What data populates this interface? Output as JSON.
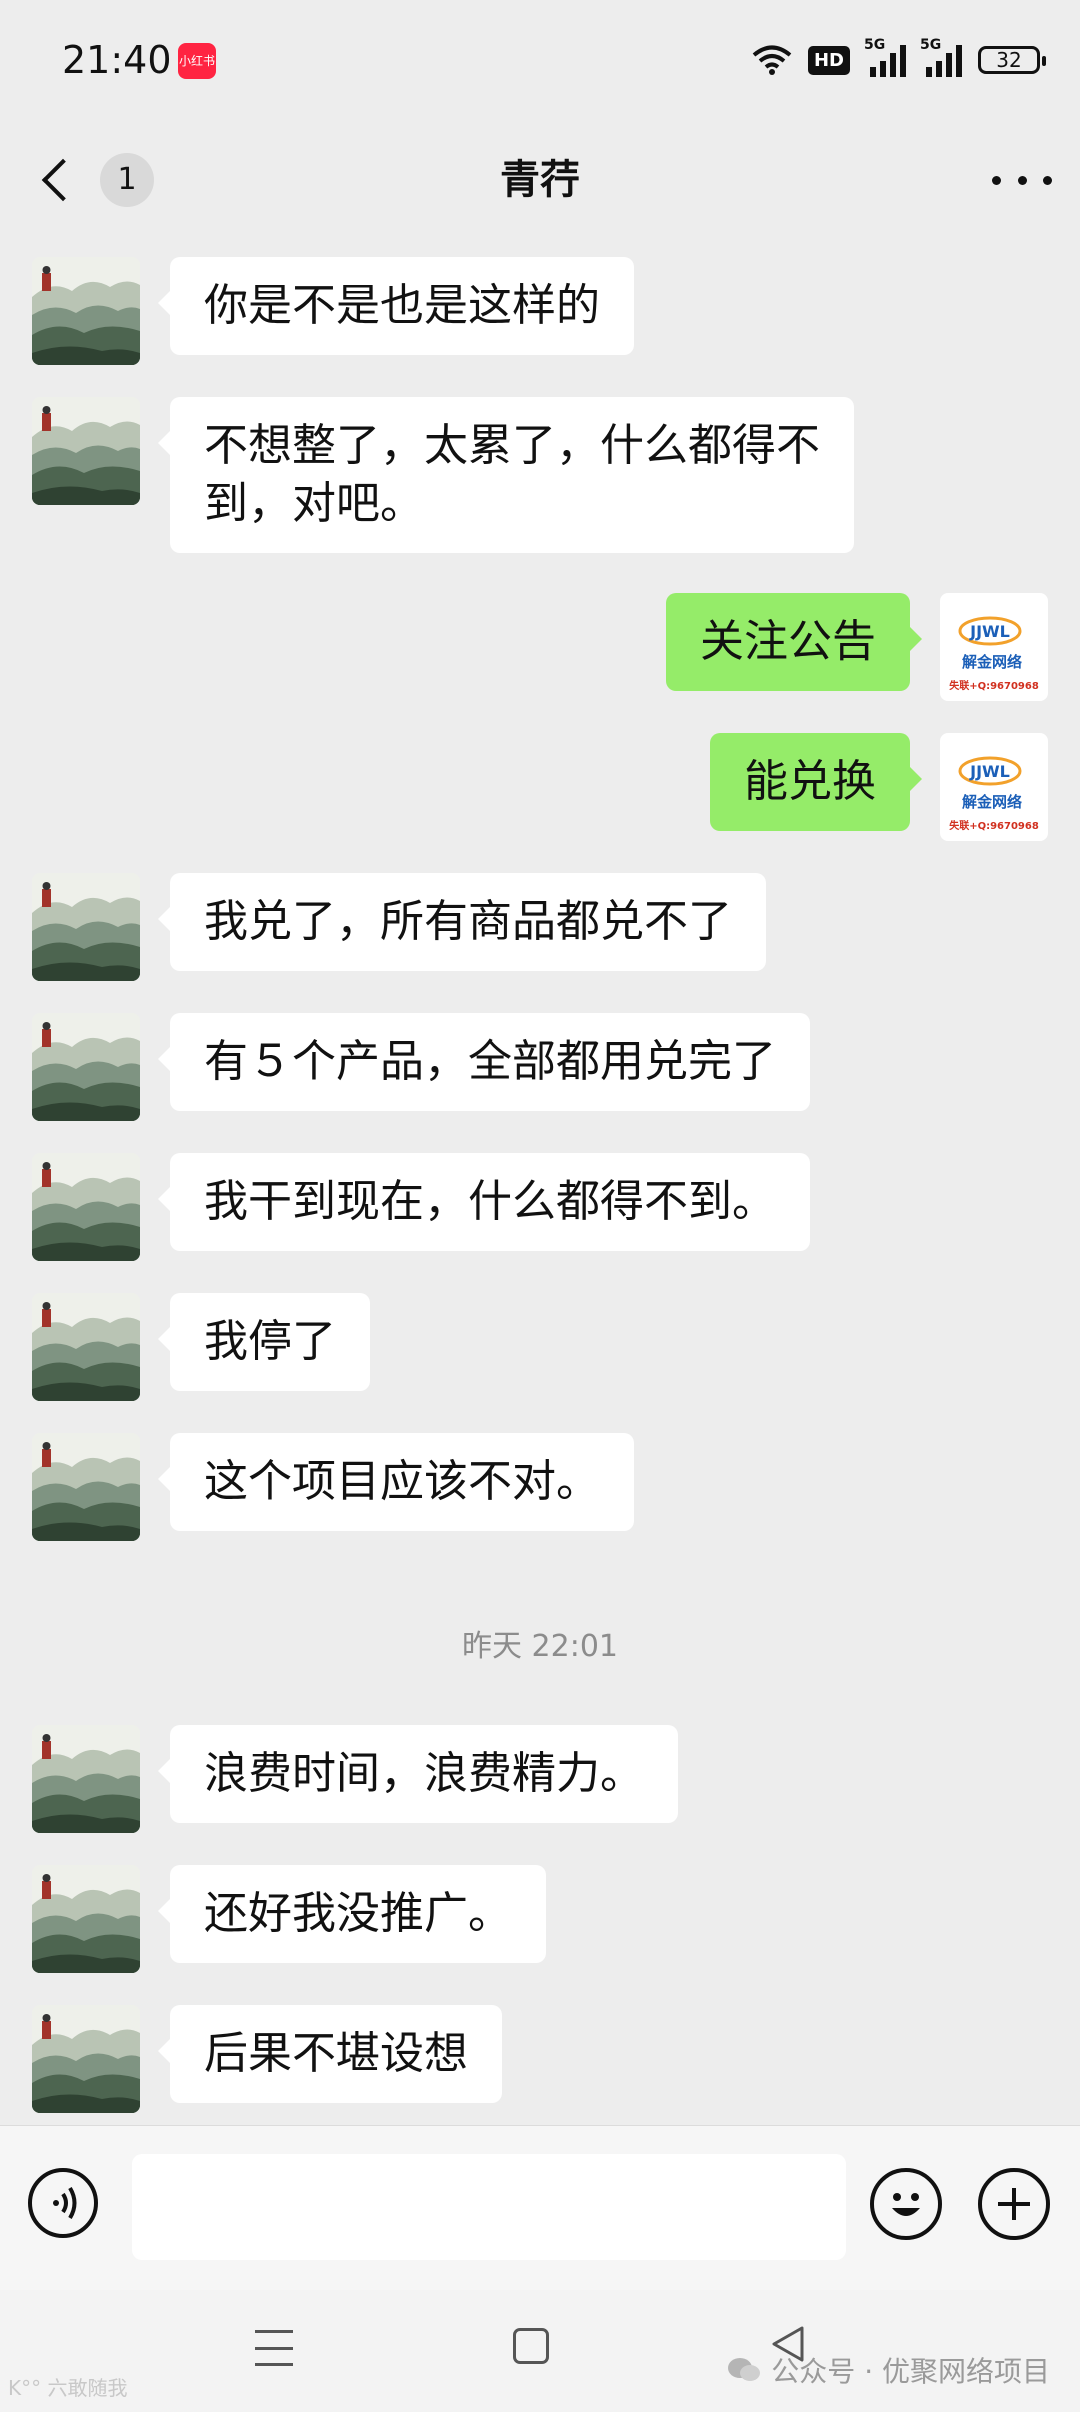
{
  "status_bar": {
    "time": "21:40",
    "app_badge": "小红书",
    "hd_label": "HD",
    "signal1_label": "5G",
    "signal2_label": "5G",
    "battery": "32"
  },
  "header": {
    "unread_count": "1",
    "title": "青荇"
  },
  "messages": [
    {
      "side": "left",
      "text": "你是不是也是这样的"
    },
    {
      "side": "left",
      "text": "不想整了，太累了，什么都得不\n到，对吧。"
    },
    {
      "side": "right",
      "text": "关注公告"
    },
    {
      "side": "right",
      "text": "能兑换"
    },
    {
      "side": "left",
      "text": "我兑了，所有商品都兑不了"
    },
    {
      "side": "left",
      "text": "有５个产品，全部都用兑完了"
    },
    {
      "side": "left",
      "text": "我干到现在，什么都得不到。"
    },
    {
      "side": "left",
      "text": "我停了"
    },
    {
      "side": "left",
      "text": "这个项目应该不对。"
    },
    {
      "side": "left",
      "text": "浪费时间，浪费精力。"
    },
    {
      "side": "left",
      "text": "还好我没推广。"
    },
    {
      "side": "left",
      "text": "后果不堪设想"
    }
  ],
  "timestamp": "昨天 22:01",
  "my_avatar": {
    "logo_text": "JJWL",
    "name_text": "解金网络",
    "contact_text": "失联+Q:9670968"
  },
  "input": {
    "placeholder": ""
  },
  "watermark": {
    "left": "K°° 六敢随我",
    "right": "公众号 · 优聚网络项目"
  }
}
